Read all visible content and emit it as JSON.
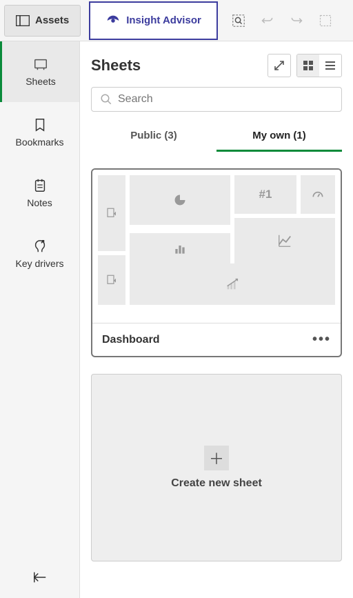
{
  "topbar": {
    "assets_label": "Assets",
    "insight_label": "Insight Advisor"
  },
  "sidebar": {
    "items": [
      {
        "label": "Sheets"
      },
      {
        "label": "Bookmarks"
      },
      {
        "label": "Notes"
      },
      {
        "label": "Key drivers"
      }
    ]
  },
  "content": {
    "title": "Sheets",
    "search_placeholder": "Search",
    "tabs": {
      "public": "Public (3)",
      "my_own": "My own (1)"
    },
    "card": {
      "title": "Dashboard",
      "tile_num": "#1"
    },
    "create_label": "Create new sheet"
  }
}
